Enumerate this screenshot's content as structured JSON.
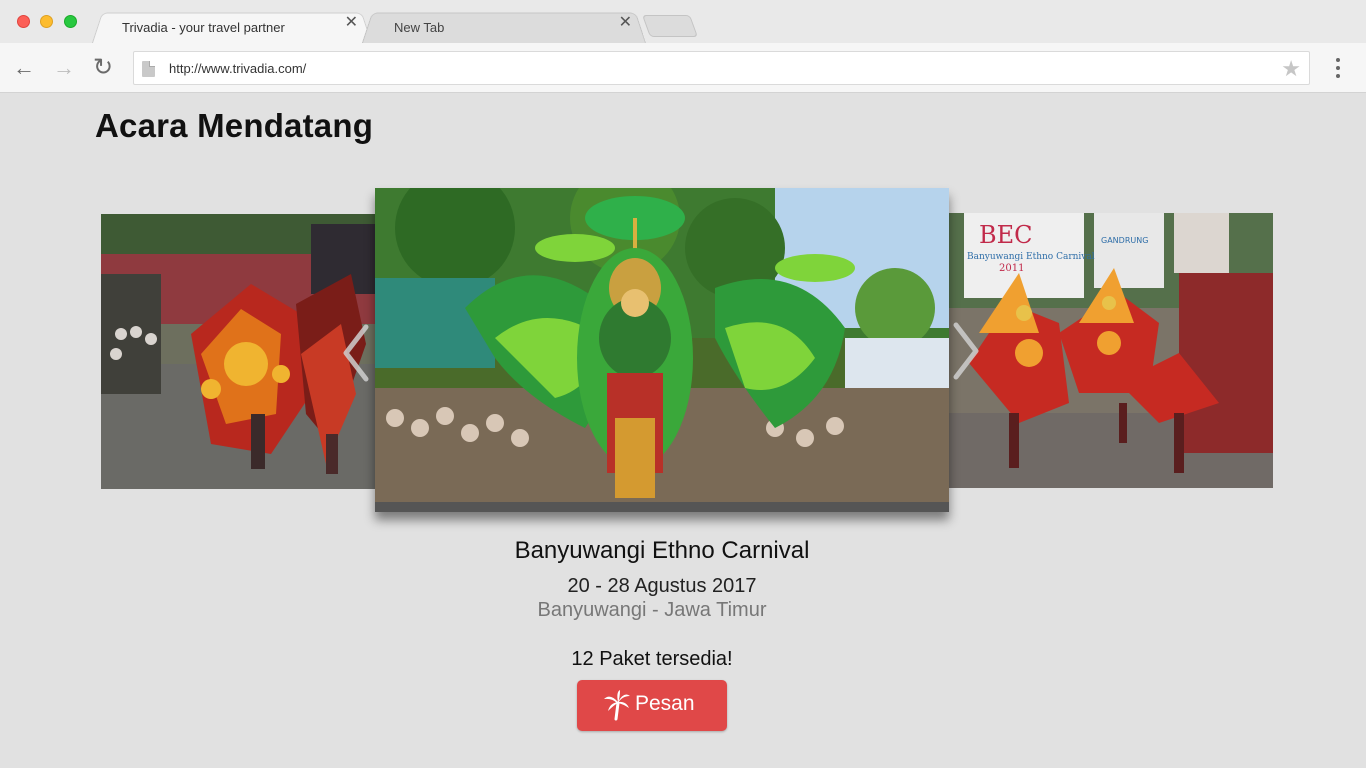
{
  "browser": {
    "tabs": [
      {
        "title": "Trivadia - your travel partner",
        "active": true
      },
      {
        "title": "New Tab",
        "active": false
      }
    ],
    "close_glyph": "✕",
    "url": "http://www.trivadia.com/",
    "icons": {
      "back": "←",
      "forward": "→",
      "reload": "↻",
      "star": "★"
    }
  },
  "page": {
    "section_title": "Acara Mendatang",
    "event": {
      "name": "Banyuwangi Ethno Carnival",
      "date": "20 - 28 Agustus 2017",
      "location": "Banyuwangi - Jawa Timur",
      "packages": "12 Paket tersedia!",
      "book_label": "Pesan"
    },
    "carousel": {
      "slides": [
        "left-photo",
        "center-photo",
        "right-photo"
      ],
      "right_banner_text": "BEC",
      "right_banner_sub": "Banyuwangi Ethno Carnival",
      "right_banner_year": "2011",
      "right_sign_text": "GANDRUNG"
    }
  },
  "colors": {
    "page_bg": "#e1e1e1",
    "book_button": "#e04848",
    "location_text": "#777777"
  }
}
